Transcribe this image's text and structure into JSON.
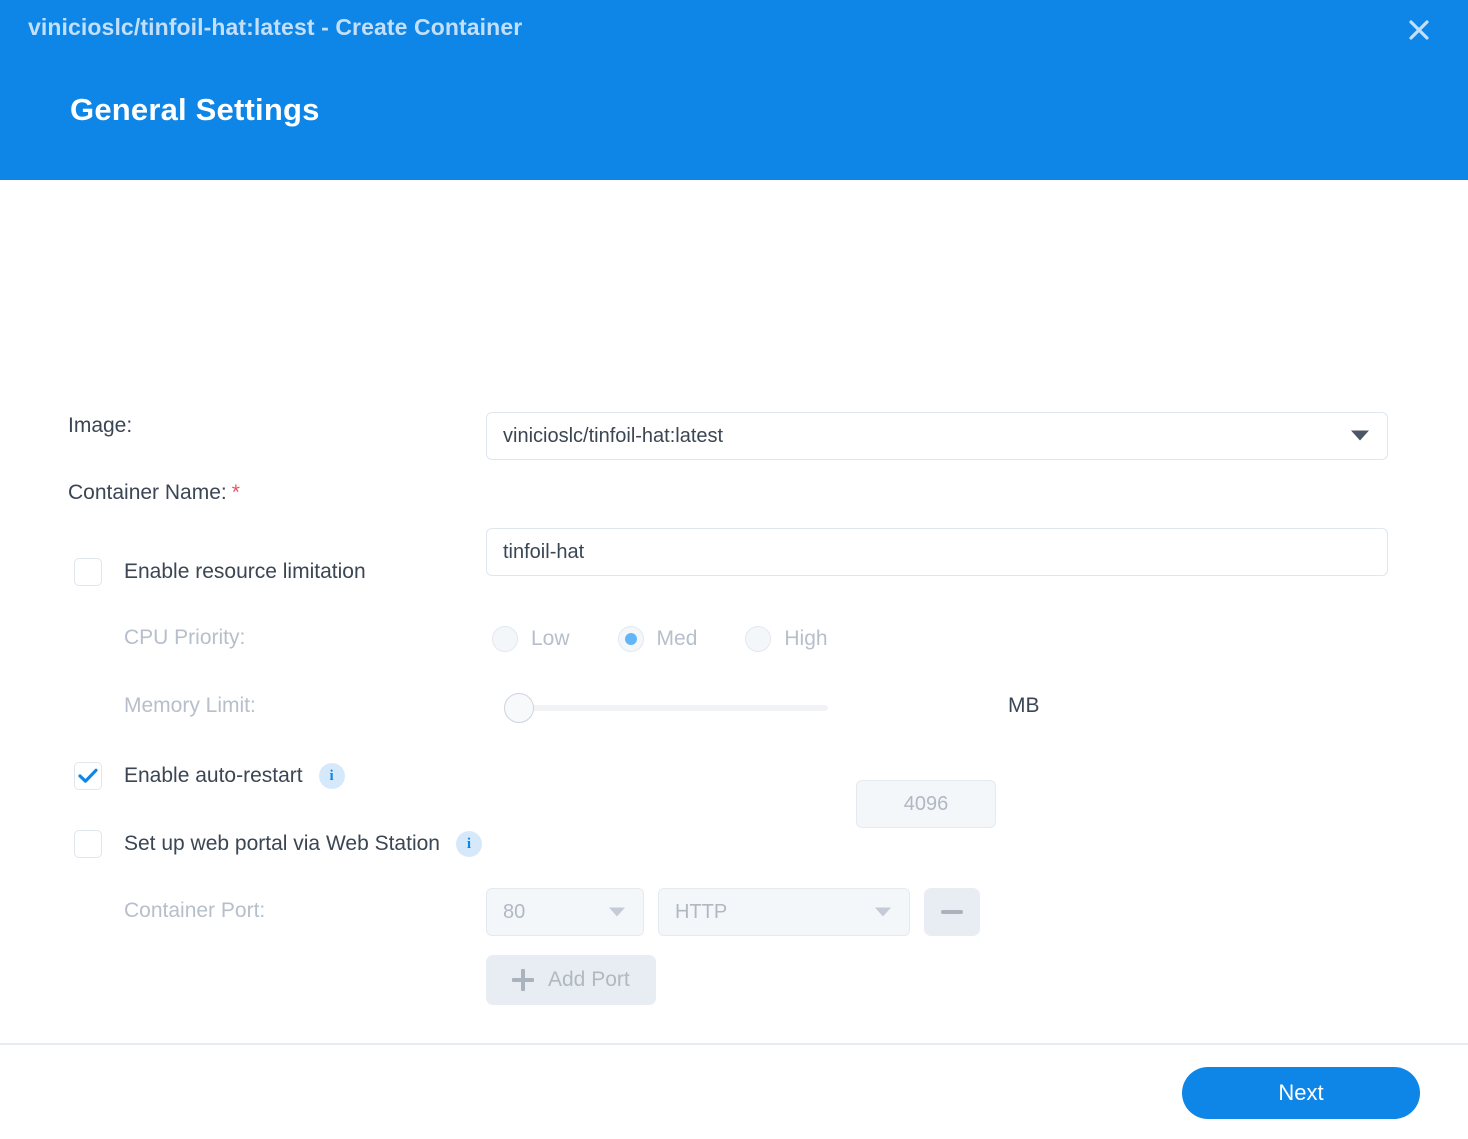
{
  "header": {
    "title": "vinicioslc/tinfoil-hat:latest - Create Container",
    "subtitle": "General Settings",
    "close_icon": "close-icon",
    "accent_color": "#0d86e8"
  },
  "form": {
    "image": {
      "label": "Image:",
      "value": "vinicioslc/tinfoil-hat:latest",
      "caret_icon": "chevron-down-icon"
    },
    "container_name": {
      "label": "Container Name:",
      "required_marker": "*",
      "value": "tinfoil-hat",
      "required_color": "#e8555f"
    },
    "resource_limitation": {
      "label": "Enable resource limitation",
      "checked": false
    },
    "cpu_priority": {
      "label": "CPU Priority:",
      "options": [
        "Low",
        "Med",
        "High"
      ],
      "selected": "Med",
      "disabled": true
    },
    "memory_limit": {
      "label": "Memory Limit:",
      "value": "4096",
      "unit": "MB",
      "disabled": true,
      "slider_position_percent": 0
    },
    "auto_restart": {
      "label": "Enable auto-restart",
      "checked": true,
      "info_icon": "info-icon",
      "info_glyph": "i"
    },
    "web_portal": {
      "label": "Set up web portal via Web Station",
      "checked": false,
      "info_icon": "info-icon",
      "info_glyph": "i"
    },
    "container_port": {
      "label": "Container Port:",
      "port_value": "80",
      "protocol_value": "HTTP",
      "caret_icon": "chevron-down-icon",
      "remove_icon": "minus-icon",
      "disabled": true
    },
    "add_port": {
      "label": "Add Port",
      "plus_icon": "plus-icon",
      "disabled": true
    }
  },
  "footer": {
    "next_label": "Next"
  }
}
